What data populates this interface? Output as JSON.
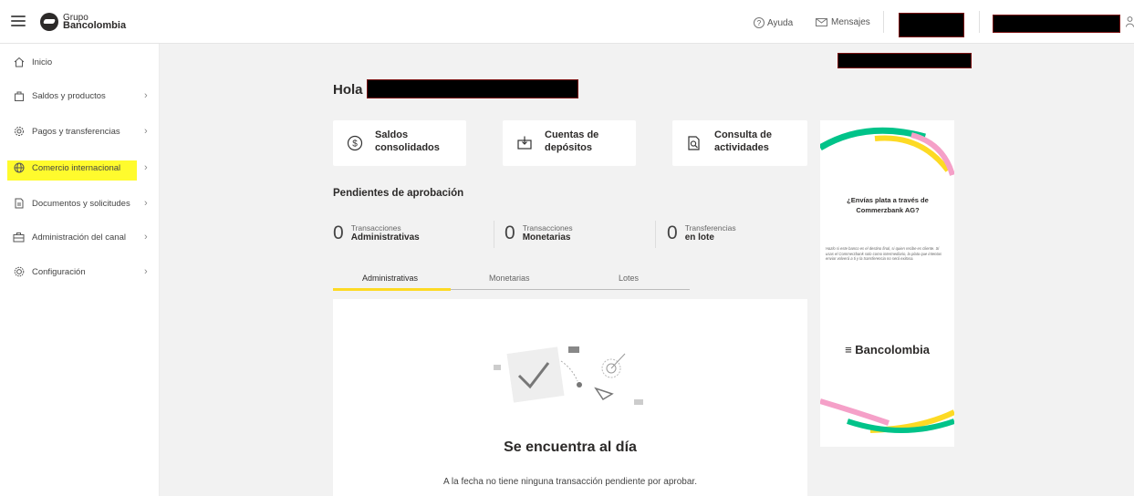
{
  "header": {
    "brand_small": "Grupo",
    "brand_big": "Bancolombia",
    "help_label": "Ayuda",
    "messages_label": "Mensajes"
  },
  "sidebar": {
    "items": [
      {
        "label": "Inicio",
        "icon": "home-icon"
      },
      {
        "label": "Saldos y productos",
        "icon": "bag-icon"
      },
      {
        "label": "Pagos y transferencias",
        "icon": "gear-money-icon"
      },
      {
        "label": "Comercio internacional",
        "icon": "globe-icon",
        "highlighted": true
      },
      {
        "label": "Documentos y solicitudes",
        "icon": "document-icon"
      },
      {
        "label": "Administración del canal",
        "icon": "briefcase-icon"
      },
      {
        "label": "Configuración",
        "icon": "settings-icon"
      }
    ],
    "highlight_color": "#fffb2d"
  },
  "main": {
    "greeting": "Hola",
    "cards": [
      {
        "label_line1": "Saldos",
        "label_line2": "consolidados",
        "icon": "dollar-circle-icon"
      },
      {
        "label_line1": "Cuentas de",
        "label_line2": "depósitos",
        "icon": "deposit-icon"
      },
      {
        "label_line1": "Consulta de",
        "label_line2": "actividades",
        "icon": "search-document-icon"
      }
    ],
    "pending_title": "Pendientes de aprobación",
    "stats": [
      {
        "count": "0",
        "line1": "Transacciones",
        "line2": "Administrativas"
      },
      {
        "count": "0",
        "line1": "Transacciones",
        "line2": "Monetarias"
      },
      {
        "count": "0",
        "line1": "Transferencias",
        "line2": "en lote"
      }
    ],
    "tabs": [
      {
        "label": "Administrativas",
        "active": true
      },
      {
        "label": "Monetarias",
        "active": false
      },
      {
        "label": "Lotes",
        "active": false
      }
    ],
    "empty_title": "Se encuentra al día",
    "empty_text": "A la fecha no tiene ninguna transacción pendiente por aprobar."
  },
  "banner": {
    "heading": "¿Envías plata a través de Commerzbank AG?",
    "small_text": "Hazlo si este banco es el destino final, si quien recibe es cliente. Si usas el Commerzbank solo como intermediario, la plata que intentas enviar volverá a ti y la transferencia no será exitosa.",
    "logo_text": "Bancolombia"
  },
  "colors": {
    "accent_yellow": "#fdda24",
    "green": "#00c389",
    "pink": "#f5a0c8"
  }
}
